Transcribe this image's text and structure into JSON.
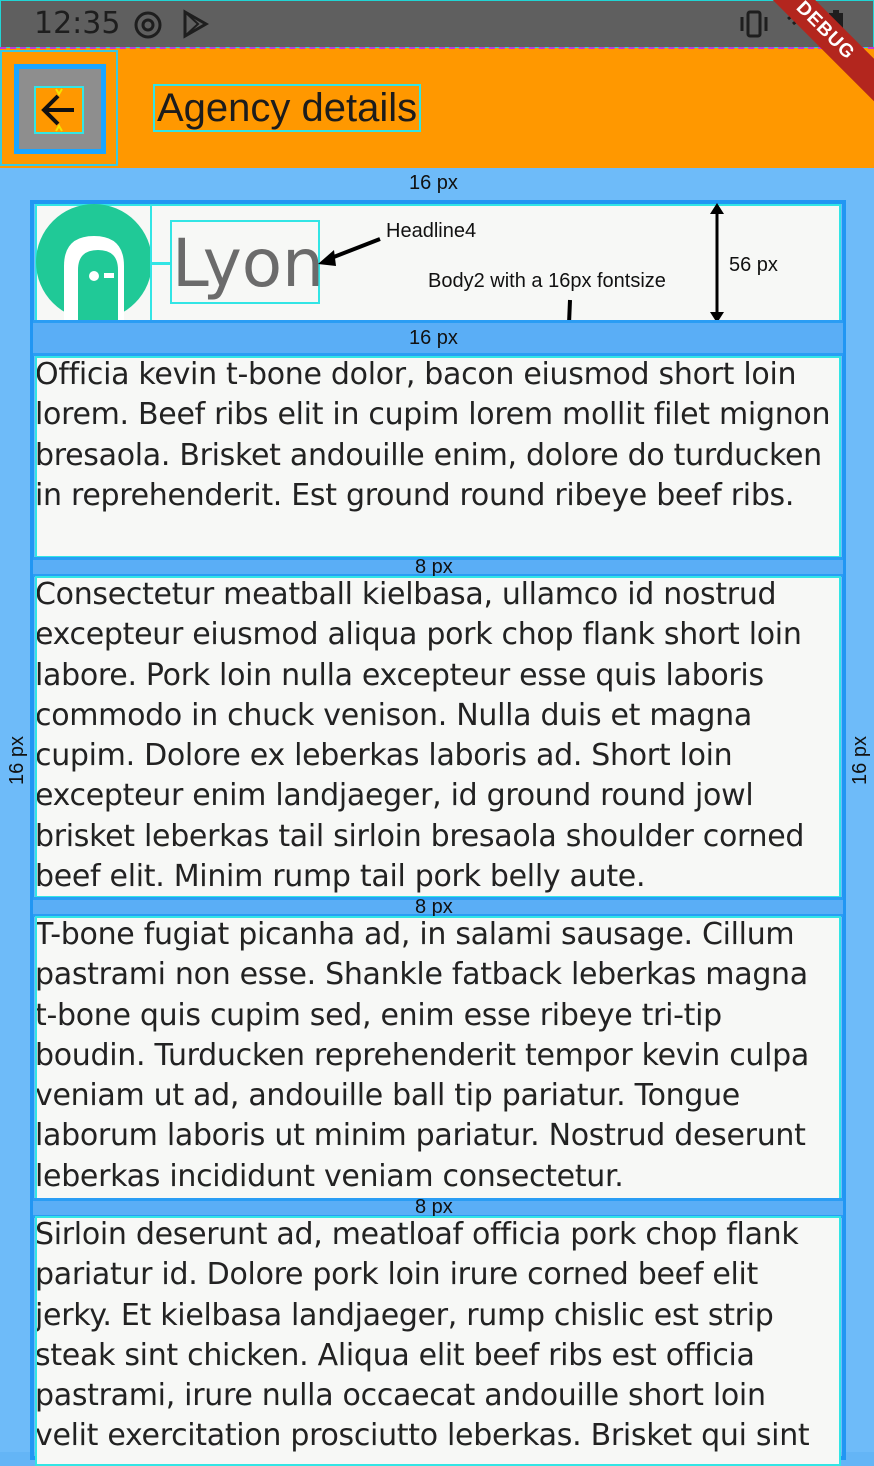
{
  "status_bar": {
    "time": "12:35",
    "icons": [
      "at-sign-icon",
      "play-store-icon",
      "vibrate-icon",
      "wifi-icon",
      "battery-icon"
    ]
  },
  "app_bar": {
    "title": "Agency details",
    "back_icon": "arrow-back-icon",
    "color": "#ff9800"
  },
  "debug_banner": "DEBUG",
  "header": {
    "agency_name": "Lyon",
    "logo_color": "#20c997"
  },
  "annotations": {
    "top_padding": "16 px",
    "header_gap": "16 px",
    "left_padding": "16 px",
    "right_padding": "16 px",
    "gap1": "8 px",
    "gap2": "8 px",
    "gap3": "8 px",
    "headline_label": "Headline4",
    "body_label": "Body2 with a 16px fontsize",
    "height_label": "56 px"
  },
  "paragraphs": [
    "Officia kevin t-bone dolor, bacon eiusmod short loin lorem.  Beef ribs elit in cupim lorem mollit filet mignon bresaola.  Brisket andouille enim, dolore do turducken in reprehenderit.  Est ground round ribeye beef ribs.",
    "Consectetur meatball kielbasa, ullamco id nostrud excepteur eiusmod aliqua pork chop flank short loin labore.  Pork loin nulla excepteur esse quis laboris commodo in chuck venison.  Nulla duis et magna cupim.  Dolore ex leberkas laboris ad.  Short loin excepteur enim landjaeger, id ground round jowl brisket leberkas tail sirloin bresaola shoulder corned beef elit.  Minim rump tail pork belly aute.",
    "T-bone fugiat picanha ad, in salami sausage.  Cillum pastrami non esse.  Shankle fatback leberkas magna t-bone quis cupim sed, enim esse ribeye tri-tip boudin.  Turducken reprehenderit tempor kevin culpa veniam ut ad, andouille ball tip pariatur.  Tongue laborum laboris ut minim pariatur.  Nostrud deserunt leberkas incididunt veniam consectetur.",
    "Sirloin deserunt ad, meatloaf officia pork chop flank pariatur id.  Dolore pork loin irure corned beef elit jerky.  Et kielbasa landjaeger, rump chislic est strip steak sint chicken.  Aliqua elit beef ribs est officia pastrami, irure nulla occaecat andouille short loin velit exercitation prosciutto leberkas.  Brisket qui sint"
  ]
}
